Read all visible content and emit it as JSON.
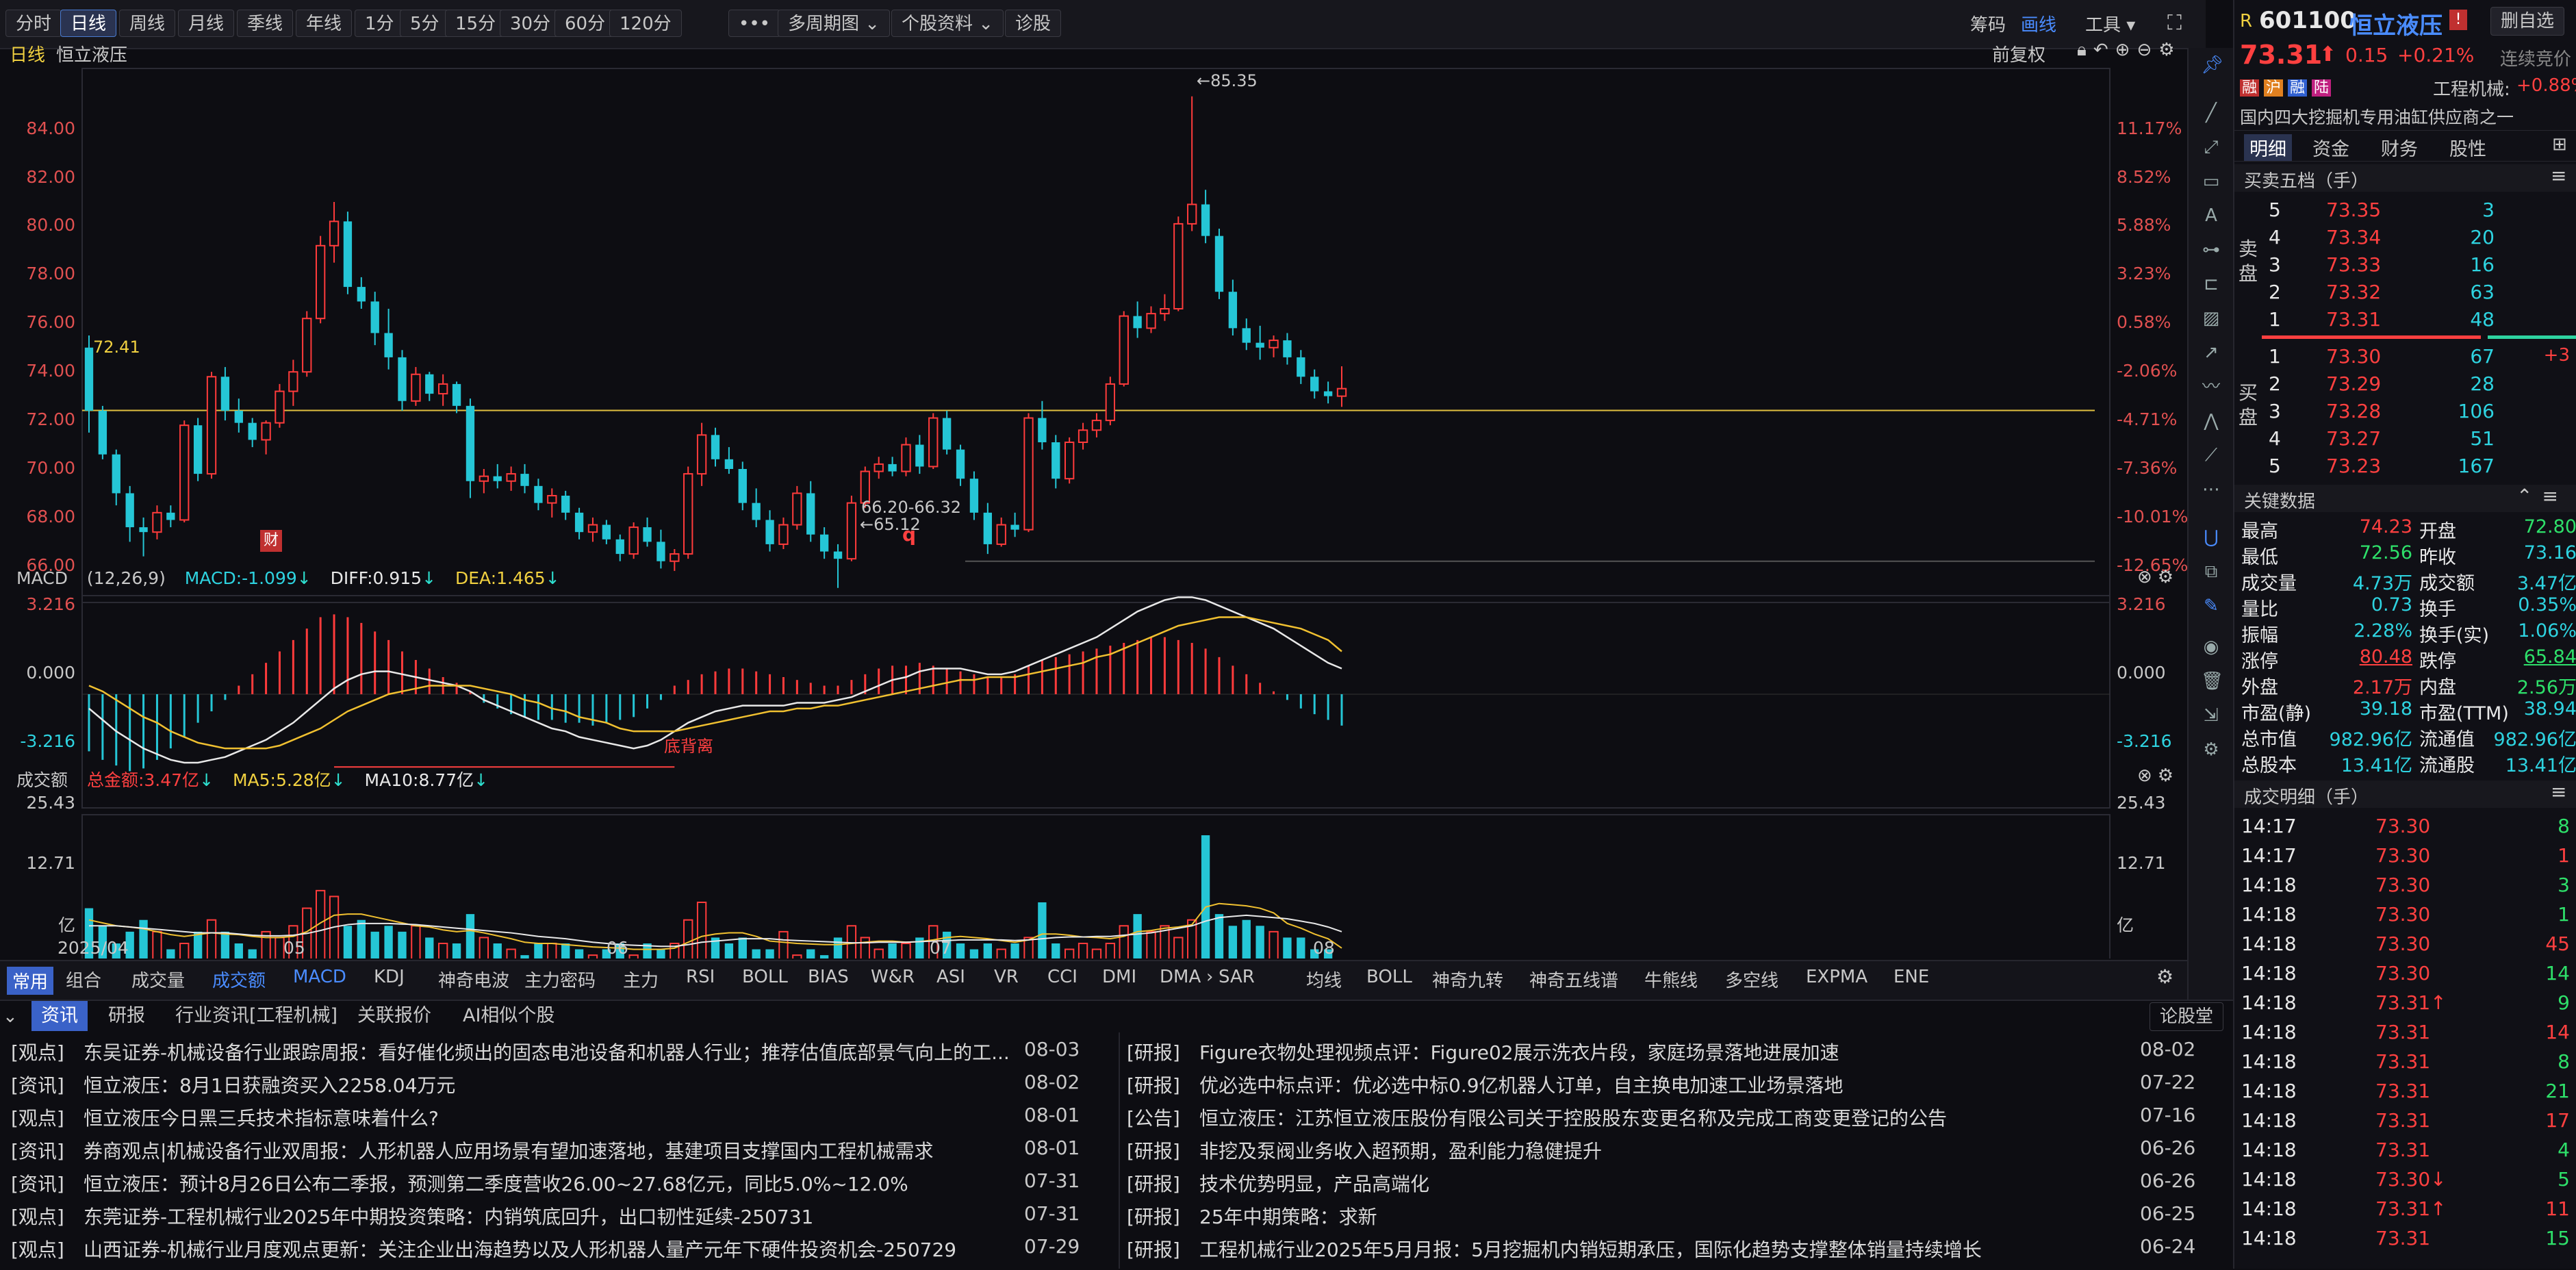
{
  "toolbar": {
    "periods": [
      "分时",
      "日线",
      "周线",
      "月线",
      "季线",
      "年线",
      "1分",
      "5分",
      "15分",
      "30分",
      "60分",
      "120分"
    ],
    "active": "日线",
    "more": "•••",
    "multi_period": "多周期图",
    "stock_info": "个股资料",
    "diagnose": "诊股",
    "chip": "筹码",
    "draw_line": "画线",
    "tools": "工具"
  },
  "chart": {
    "period_label": "日线",
    "stock_name": "恒立液压",
    "restore": "前复权",
    "price_axis": [
      "84.00",
      "82.00",
      "80.00",
      "78.00",
      "76.00",
      "74.00",
      "72.00",
      "70.00",
      "68.00",
      "66.00"
    ],
    "pct_axis": [
      "11.17%",
      "8.52%",
      "5.88%",
      "3.23%",
      "0.58%",
      "-2.06%",
      "-4.71%",
      "-7.36%",
      "-10.01%",
      "-12.65%"
    ],
    "high_marker": "←85.35",
    "low_marker": "←65.12",
    "range_marker": "66.20-66.32",
    "ref_line": "72.41",
    "fin_badge": "财",
    "q_mark": "q"
  },
  "macd": {
    "name": "MACD",
    "params": "(12,26,9)",
    "macd": "MACD:-1.099",
    "diff": "DIFF:0.915",
    "dea": "DEA:1.465",
    "axis_top": "3.216",
    "axis_mid": "0.000",
    "axis_bot": "-3.216",
    "divergence": "底背离"
  },
  "volume": {
    "name": "成交额",
    "total": "总金额:3.47亿",
    "ma5": "MA5:5.28亿",
    "ma10": "MA10:8.77亿",
    "axis_top": "25.43",
    "axis_mid": "12.71",
    "unit": "亿",
    "months": [
      "2025/04",
      "05",
      "06",
      "07",
      "08"
    ]
  },
  "indicator_tabs_left": [
    "常用",
    "组合",
    "成交量",
    "成交额",
    "MACD",
    "KDJ",
    "神奇电波",
    "主力密码",
    "主力",
    "RSI",
    "BOLL",
    "BIAS",
    "W&R",
    "ASI",
    "VR",
    "CCI",
    "DMI",
    "DMA",
    "SAR"
  ],
  "indicator_tabs_right": [
    "均线",
    "BOLL",
    "神奇九转",
    "神奇五线谱",
    "牛熊线",
    "多空线",
    "EXPMA",
    "ENE"
  ],
  "quote": {
    "badge": "R",
    "code": "601100",
    "name": "恒立液压",
    "add_btn": "删自选",
    "price": "73.31",
    "change": "0.15",
    "pct": "+0.21%",
    "auction": "连续竞价",
    "tags": [
      "融",
      "沪",
      "融",
      "陆"
    ],
    "industry": "工程机械:",
    "industry_pct": "+0.88%",
    "desc": "国内四大挖掘机专用油缸供应商之一",
    "tabs": [
      "明细",
      "资金",
      "财务",
      "股性"
    ]
  },
  "orderbook": {
    "title": "买卖五档（手）",
    "sell_label": "卖盘",
    "buy_label": "买盘",
    "sells": [
      {
        "lv": "5",
        "p": "73.35",
        "v": "3"
      },
      {
        "lv": "4",
        "p": "73.34",
        "v": "20"
      },
      {
        "lv": "3",
        "p": "73.33",
        "v": "16"
      },
      {
        "lv": "2",
        "p": "73.32",
        "v": "63"
      },
      {
        "lv": "1",
        "p": "73.31",
        "v": "48"
      }
    ],
    "buys": [
      {
        "lv": "1",
        "p": "73.30",
        "v": "67",
        "d": "+3"
      },
      {
        "lv": "2",
        "p": "73.29",
        "v": "28",
        "d": ""
      },
      {
        "lv": "3",
        "p": "73.28",
        "v": "106",
        "d": ""
      },
      {
        "lv": "4",
        "p": "73.27",
        "v": "51",
        "d": ""
      },
      {
        "lv": "5",
        "p": "73.23",
        "v": "167",
        "d": ""
      }
    ]
  },
  "keydata": {
    "title": "关键数据",
    "rows": [
      [
        "最高",
        "74.23",
        "开盘",
        "72.80"
      ],
      [
        "最低",
        "72.56",
        "昨收",
        "73.16"
      ],
      [
        "成交量",
        "4.73万",
        "成交额",
        "3.47亿"
      ],
      [
        "量比",
        "0.73",
        "换手",
        "0.35%"
      ],
      [
        "振幅",
        "2.28%",
        "换手(实)",
        "1.06%"
      ],
      [
        "涨停",
        "80.48",
        "跌停",
        "65.84"
      ],
      [
        "外盘",
        "2.17万",
        "内盘",
        "2.56万"
      ],
      [
        "市盈(静)",
        "39.18",
        "市盈(TTM)",
        "38.94"
      ],
      [
        "总市值",
        "982.96亿",
        "流通值",
        "982.96亿"
      ],
      [
        "总股本",
        "13.41亿",
        "流通股",
        "13.41亿"
      ]
    ]
  },
  "trades": {
    "title": "成交明细（手）",
    "rows": [
      [
        "14:17",
        "73.30",
        "8"
      ],
      [
        "14:17",
        "73.30",
        "1"
      ],
      [
        "14:18",
        "73.30",
        "3"
      ],
      [
        "14:18",
        "73.30",
        "1"
      ],
      [
        "14:18",
        "73.30",
        "45"
      ],
      [
        "14:18",
        "73.30",
        "14"
      ],
      [
        "14:18",
        "73.31↑",
        "9"
      ],
      [
        "14:18",
        "73.31",
        "14"
      ],
      [
        "14:18",
        "73.31",
        "8"
      ],
      [
        "14:18",
        "73.31",
        "21"
      ],
      [
        "14:18",
        "73.31",
        "17"
      ],
      [
        "14:18",
        "73.31",
        "4"
      ],
      [
        "14:18",
        "73.30↓",
        "5"
      ],
      [
        "14:18",
        "73.31↑",
        "11"
      ],
      [
        "14:18",
        "73.31",
        "15"
      ]
    ]
  },
  "news": {
    "tabs": [
      "资讯",
      "研报",
      "行业资讯[工程机械]",
      "关联报价",
      "AI相似个股"
    ],
    "forum": "论股堂",
    "left": [
      [
        "[观点]",
        "东吴证券-机械设备行业跟踪周报：看好催化频出的固态电池设备和机器人行业；推荐估值底部景气向上的工...",
        "08-03"
      ],
      [
        "[资讯]",
        "恒立液压：8月1日获融资买入2258.04万元",
        "08-02"
      ],
      [
        "[观点]",
        "恒立液压今日黑三兵技术指标意味着什么?",
        "08-01"
      ],
      [
        "[资讯]",
        "券商观点|机械设备行业双周报：人形机器人应用场景有望加速落地，基建项目支撑国内工程机械需求",
        "08-01"
      ],
      [
        "[资讯]",
        "恒立液压：预计8月26日公布二季报，预测第二季度营收26.00~27.68亿元，同比5.0%~12.0%",
        "07-31"
      ],
      [
        "[观点]",
        "东莞证券-工程机械行业2025年中期投资策略：内销筑底回升，出口韧性延续-250731",
        "07-31"
      ],
      [
        "[观点]",
        "山西证券-机械行业月度观点更新：关注企业出海趋势以及人形机器人量产元年下硬件投资机会-250729",
        "07-29"
      ]
    ],
    "right": [
      [
        "[研报]",
        "Figure衣物处理视频点评：Figure02展示洗衣片段，家庭场景落地进展加速",
        "08-02"
      ],
      [
        "[研报]",
        "优必选中标点评：优必选中标0.9亿机器人订单，自主换电加速工业场景落地",
        "07-22"
      ],
      [
        "[公告]",
        "恒立液压：江苏恒立液压股份有限公司关于控股股东变更名称及完成工商变更登记的公告",
        "07-16"
      ],
      [
        "[研报]",
        "非挖及泵阀业务收入超预期，盈利能力稳健提升",
        "06-26"
      ],
      [
        "[研报]",
        "技术优势明显，产品高端化",
        "06-26"
      ],
      [
        "[研报]",
        "25年中期策略：求新",
        "06-25"
      ],
      [
        "[研报]",
        "工程机械行业2025年5月月报：5月挖掘机内销短期承压，国际化趋势支撑整体销量持续增长",
        "06-24"
      ]
    ]
  },
  "chart_data": {
    "type": "candlestick",
    "yrange": [
      64.5,
      86.5
    ],
    "up_color": "#ff3b3b",
    "down_color": "#25c6d6",
    "candles": [
      [
        75.0,
        75.5,
        71.5,
        72.4
      ],
      [
        72.4,
        72.6,
        70.4,
        70.6
      ],
      [
        70.6,
        70.8,
        68.5,
        69.0
      ],
      [
        69.0,
        69.3,
        67.0,
        67.6
      ],
      [
        67.6,
        68.0,
        66.4,
        67.4
      ],
      [
        67.4,
        68.5,
        67.1,
        68.2
      ],
      [
        68.2,
        68.5,
        67.6,
        67.9
      ],
      [
        67.9,
        72.0,
        67.8,
        71.8
      ],
      [
        71.8,
        72.1,
        69.5,
        69.8
      ],
      [
        69.8,
        74.0,
        69.6,
        73.8
      ],
      [
        73.8,
        74.2,
        72.0,
        72.4
      ],
      [
        72.4,
        72.9,
        71.5,
        71.9
      ],
      [
        71.9,
        72.1,
        70.9,
        71.2
      ],
      [
        71.2,
        72.0,
        70.6,
        71.9
      ],
      [
        71.9,
        73.5,
        71.7,
        73.2
      ],
      [
        73.2,
        74.5,
        72.6,
        74.0
      ],
      [
        74.0,
        76.5,
        73.8,
        76.2
      ],
      [
        76.2,
        79.6,
        76.0,
        79.2
      ],
      [
        79.2,
        81.0,
        78.5,
        80.2
      ],
      [
        80.2,
        80.6,
        77.2,
        77.5
      ],
      [
        77.5,
        77.9,
        76.6,
        76.9
      ],
      [
        76.9,
        77.3,
        75.1,
        75.6
      ],
      [
        75.6,
        76.6,
        74.1,
        74.6
      ],
      [
        74.6,
        74.9,
        72.4,
        72.8
      ],
      [
        72.8,
        74.2,
        72.6,
        73.9
      ],
      [
        73.9,
        74.0,
        72.8,
        73.1
      ],
      [
        73.1,
        73.9,
        72.6,
        73.5
      ],
      [
        73.5,
        73.6,
        72.3,
        72.6
      ],
      [
        72.6,
        72.9,
        68.8,
        69.5
      ],
      [
        69.5,
        70.0,
        69.0,
        69.7
      ],
      [
        69.7,
        70.2,
        69.2,
        69.5
      ],
      [
        69.5,
        70.1,
        69.1,
        69.8
      ],
      [
        69.8,
        70.2,
        69.0,
        69.3
      ],
      [
        69.3,
        69.6,
        68.3,
        68.6
      ],
      [
        68.6,
        69.2,
        68.0,
        68.9
      ],
      [
        68.9,
        69.1,
        67.9,
        68.2
      ],
      [
        68.2,
        68.4,
        67.1,
        67.4
      ],
      [
        67.4,
        68.0,
        67.0,
        67.7
      ],
      [
        67.7,
        67.9,
        66.9,
        67.1
      ],
      [
        67.1,
        67.3,
        66.2,
        66.5
      ],
      [
        66.5,
        67.8,
        66.3,
        67.6
      ],
      [
        67.6,
        68.0,
        66.8,
        67.0
      ],
      [
        67.0,
        67.5,
        65.9,
        66.2
      ],
      [
        66.2,
        66.7,
        65.8,
        66.5
      ],
      [
        66.5,
        70.1,
        66.3,
        69.8
      ],
      [
        69.8,
        71.9,
        69.3,
        71.4
      ],
      [
        71.4,
        71.7,
        70.1,
        70.4
      ],
      [
        70.4,
        70.9,
        69.8,
        70.0
      ],
      [
        70.0,
        70.3,
        68.3,
        68.6
      ],
      [
        68.6,
        69.2,
        67.6,
        67.9
      ],
      [
        67.9,
        68.3,
        66.6,
        66.9
      ],
      [
        66.9,
        68.0,
        66.7,
        67.7
      ],
      [
        67.7,
        69.3,
        67.5,
        69.0
      ],
      [
        69.0,
        69.5,
        67.0,
        67.3
      ],
      [
        67.3,
        67.6,
        66.3,
        66.6
      ],
      [
        66.6,
        66.9,
        65.1,
        66.3
      ],
      [
        66.3,
        68.9,
        66.2,
        68.6
      ],
      [
        68.6,
        70.1,
        68.4,
        69.9
      ],
      [
        69.9,
        70.5,
        69.6,
        70.2
      ],
      [
        70.2,
        70.5,
        69.7,
        69.9
      ],
      [
        69.9,
        71.3,
        69.7,
        71.0
      ],
      [
        71.0,
        71.4,
        69.8,
        70.1
      ],
      [
        70.1,
        72.3,
        70.0,
        72.1
      ],
      [
        72.1,
        72.4,
        70.6,
        70.8
      ],
      [
        70.8,
        71.0,
        69.3,
        69.6
      ],
      [
        69.6,
        69.9,
        67.9,
        68.2
      ],
      [
        68.2,
        68.6,
        66.5,
        66.9
      ],
      [
        66.9,
        68.0,
        66.8,
        67.7
      ],
      [
        67.7,
        68.2,
        67.2,
        67.5
      ],
      [
        67.5,
        72.3,
        67.4,
        72.1
      ],
      [
        72.1,
        72.8,
        70.8,
        71.1
      ],
      [
        71.1,
        71.4,
        69.2,
        69.6
      ],
      [
        69.6,
        71.3,
        69.4,
        71.1
      ],
      [
        71.1,
        71.9,
        70.8,
        71.6
      ],
      [
        71.6,
        72.3,
        71.3,
        72.0
      ],
      [
        72.0,
        73.8,
        71.8,
        73.5
      ],
      [
        73.5,
        76.5,
        73.4,
        76.3
      ],
      [
        76.3,
        76.9,
        75.4,
        75.8
      ],
      [
        75.8,
        76.7,
        75.6,
        76.4
      ],
      [
        76.4,
        77.2,
        76.1,
        76.6
      ],
      [
        76.6,
        80.4,
        76.5,
        80.1
      ],
      [
        80.1,
        85.35,
        79.8,
        80.9
      ],
      [
        80.9,
        81.5,
        79.3,
        79.6
      ],
      [
        79.6,
        79.9,
        77.0,
        77.3
      ],
      [
        77.3,
        77.8,
        75.5,
        75.8
      ],
      [
        75.8,
        76.2,
        74.9,
        75.2
      ],
      [
        75.2,
        75.9,
        74.5,
        75.0
      ],
      [
        75.0,
        75.5,
        74.6,
        75.3
      ],
      [
        75.3,
        75.6,
        74.3,
        74.6
      ],
      [
        74.6,
        74.9,
        73.5,
        73.8
      ],
      [
        73.8,
        74.1,
        72.9,
        73.2
      ],
      [
        73.2,
        73.6,
        72.7,
        73.0
      ],
      [
        73.0,
        74.23,
        72.56,
        73.31
      ]
    ],
    "macd_hist": [
      -2.0,
      -2.3,
      -2.5,
      -2.7,
      -2.6,
      -2.3,
      -1.9,
      -1.5,
      -1.0,
      -0.6,
      -0.2,
      0.3,
      0.7,
      1.1,
      1.5,
      1.9,
      2.3,
      2.7,
      2.8,
      2.7,
      2.5,
      2.2,
      1.9,
      1.5,
      1.2,
      0.9,
      0.6,
      0.4,
      0.1,
      -0.3,
      -0.5,
      -0.7,
      -0.8,
      -0.9,
      -0.9,
      -1.0,
      -1.0,
      -1.1,
      -1.0,
      -0.9,
      -0.8,
      -0.5,
      -0.2,
      0.3,
      0.5,
      0.7,
      0.8,
      0.9,
      0.9,
      0.8,
      0.7,
      0.6,
      0.5,
      0.4,
      0.3,
      0.3,
      0.5,
      0.7,
      0.9,
      1.0,
      1.0,
      1.1,
      1.0,
      0.9,
      0.8,
      0.7,
      0.6,
      0.6,
      0.7,
      1.0,
      1.2,
      1.3,
      1.4,
      1.5,
      1.6,
      1.7,
      1.8,
      1.9,
      2.0,
      2.0,
      1.9,
      1.8,
      1.6,
      1.3,
      1.0,
      0.7,
      0.4,
      0.1,
      -0.2,
      -0.5,
      -0.7,
      -0.9,
      -1.1
    ],
    "diff": [
      -0.5,
      -0.9,
      -1.3,
      -1.6,
      -1.9,
      -2.1,
      -2.3,
      -2.4,
      -2.4,
      -2.3,
      -2.2,
      -2.0,
      -1.8,
      -1.6,
      -1.3,
      -1.0,
      -0.6,
      -0.2,
      0.2,
      0.5,
      0.7,
      0.8,
      0.8,
      0.7,
      0.6,
      0.5,
      0.4,
      0.3,
      0.1,
      -0.2,
      -0.4,
      -0.6,
      -0.8,
      -1.0,
      -1.2,
      -1.3,
      -1.5,
      -1.6,
      -1.7,
      -1.8,
      -1.9,
      -1.8,
      -1.6,
      -1.3,
      -1.0,
      -0.8,
      -0.6,
      -0.5,
      -0.4,
      -0.4,
      -0.4,
      -0.4,
      -0.3,
      -0.3,
      -0.3,
      -0.2,
      -0.1,
      0.1,
      0.3,
      0.5,
      0.6,
      0.8,
      0.9,
      0.9,
      0.9,
      0.8,
      0.7,
      0.7,
      0.8,
      1.0,
      1.2,
      1.4,
      1.6,
      1.8,
      2.0,
      2.3,
      2.6,
      2.9,
      3.1,
      3.3,
      3.4,
      3.4,
      3.3,
      3.1,
      2.9,
      2.7,
      2.5,
      2.3,
      2.0,
      1.7,
      1.4,
      1.1,
      0.9
    ],
    "dea": [
      0.3,
      0.1,
      -0.2,
      -0.5,
      -0.8,
      -1.0,
      -1.3,
      -1.5,
      -1.7,
      -1.8,
      -1.9,
      -1.9,
      -1.9,
      -1.9,
      -1.8,
      -1.6,
      -1.4,
      -1.2,
      -0.9,
      -0.6,
      -0.4,
      -0.2,
      0.0,
      0.1,
      0.2,
      0.3,
      0.3,
      0.3,
      0.3,
      0.2,
      0.1,
      0.0,
      -0.2,
      -0.3,
      -0.5,
      -0.6,
      -0.8,
      -0.9,
      -1.0,
      -1.2,
      -1.3,
      -1.3,
      -1.3,
      -1.3,
      -1.2,
      -1.1,
      -1.0,
      -0.9,
      -0.8,
      -0.7,
      -0.6,
      -0.6,
      -0.5,
      -0.5,
      -0.4,
      -0.4,
      -0.3,
      -0.2,
      -0.1,
      0.0,
      0.1,
      0.2,
      0.3,
      0.4,
      0.5,
      0.5,
      0.6,
      0.6,
      0.6,
      0.7,
      0.8,
      0.9,
      1.0,
      1.1,
      1.3,
      1.4,
      1.6,
      1.8,
      2.0,
      2.2,
      2.4,
      2.5,
      2.6,
      2.7,
      2.7,
      2.7,
      2.6,
      2.5,
      2.4,
      2.3,
      2.1,
      1.9,
      1.5
    ],
    "macd_range": [
      -3.216,
      3.216
    ],
    "volume": [
      13,
      10,
      7,
      9,
      11,
      9,
      6,
      7,
      9,
      11,
      9,
      7,
      6,
      9,
      8,
      10,
      13,
      16,
      15,
      10,
      11,
      9,
      10,
      9,
      10,
      8,
      7,
      7,
      12,
      8,
      7,
      6,
      5,
      7,
      7,
      7,
      6,
      5,
      6,
      7,
      5,
      7,
      6,
      7,
      11,
      14,
      8,
      7,
      8,
      6,
      6,
      9,
      5,
      6,
      5,
      8,
      10,
      8,
      6,
      7,
      7,
      8,
      10,
      9,
      7,
      6,
      7,
      6,
      7,
      8,
      14,
      7,
      6,
      7,
      6,
      7,
      10,
      12,
      9,
      10,
      8,
      11,
      25.43,
      12,
      10,
      11,
      10,
      9,
      8,
      8,
      6,
      6,
      4
    ],
    "vol_ma5": [
      11,
      10.5,
      10,
      9.8,
      9.5,
      9,
      8.5,
      8.2,
      8.5,
      8.8,
      8.6,
      8.5,
      8.2,
      8,
      8,
      8.2,
      9,
      10.5,
      11.8,
      12,
      12,
      11.5,
      11,
      10.5,
      10,
      9.8,
      9.3,
      9,
      9.2,
      8.8,
      8.3,
      7.8,
      7.2,
      7,
      7,
      6.8,
      6.6,
      6.4,
      6.3,
      6.2,
      6,
      6,
      6,
      6.2,
      7.2,
      8.2,
      8.6,
      8.8,
      8.8,
      8.2,
      7.4,
      7.2,
      7,
      6.9,
      6.8,
      6.8,
      7,
      7.2,
      7.4,
      7.4,
      7.2,
      7.3,
      7.6,
      8,
      8.2,
      8,
      7.8,
      7.5,
      7.2,
      7.6,
      8.6,
      8.6,
      8.4,
      8.1,
      8,
      7.8,
      8.2,
      9,
      9.2,
      9.6,
      9.8,
      10.2,
      13.2,
      13.8,
      13.6,
      13.4,
      13,
      12.2,
      10.4,
      9.6,
      8.6,
      7.8,
      6.2
    ],
    "vol_ma10": [
      10,
      10,
      10,
      9.8,
      9.6,
      9.4,
      9.2,
      9,
      8.8,
      8.8,
      8.8,
      8.6,
      8.4,
      8.3,
      8.3,
      8.4,
      8.7,
      9.2,
      9.8,
      10.2,
      10.4,
      10.4,
      10.4,
      10.3,
      10.2,
      10,
      9.8,
      9.6,
      9.4,
      9.2,
      9,
      8.8,
      8.5,
      8.2,
      8,
      7.8,
      7.5,
      7.2,
      7,
      6.8,
      6.7,
      6.6,
      6.5,
      6.5,
      6.8,
      7.2,
      7.4,
      7.6,
      7.8,
      7.8,
      7.8,
      7.6,
      7.5,
      7.4,
      7.3,
      7.2,
      7.1,
      7.1,
      7.2,
      7.2,
      7.2,
      7.3,
      7.4,
      7.5,
      7.6,
      7.6,
      7.6,
      7.6,
      7.5,
      7.6,
      7.8,
      8,
      8.1,
      8.1,
      8.2,
      8.2,
      8.4,
      8.6,
      8.8,
      9.2,
      9.6,
      10,
      10.8,
      11.4,
      11.6,
      11.8,
      11.6,
      11.4,
      11.2,
      10.8,
      10.4,
      9.8,
      9
    ],
    "vol_range": [
      0,
      25.43
    ]
  }
}
